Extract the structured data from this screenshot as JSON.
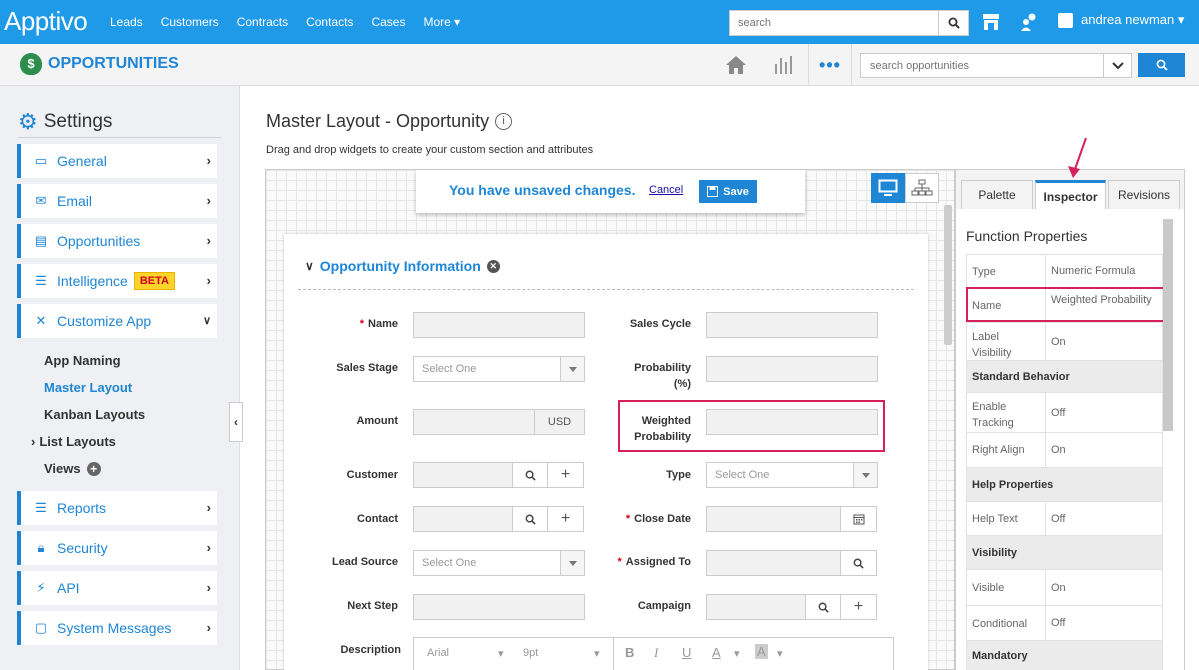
{
  "topnav": {
    "logo": "Apptivo",
    "links": [
      "Leads",
      "Customers",
      "Contracts",
      "Contacts",
      "Cases",
      "More ▾"
    ],
    "search_placeholder": "search",
    "user_name": "andrea newman ▾"
  },
  "appbar": {
    "title": "OPPORTUNITIES",
    "search_placeholder": "search opportunities"
  },
  "sidebar": {
    "heading": "Settings",
    "items": [
      {
        "label": "General",
        "icon": "monitor-icon"
      },
      {
        "label": "Email",
        "icon": "envelope-icon"
      },
      {
        "label": "Opportunities",
        "icon": "form-icon"
      },
      {
        "label": "Intelligence",
        "icon": "list-icon",
        "badge": "BETA"
      },
      {
        "label": "Customize App",
        "icon": "tools-icon"
      },
      {
        "label": "Reports",
        "icon": "report-icon"
      },
      {
        "label": "Security",
        "icon": "lock-icon"
      },
      {
        "label": "API",
        "icon": "plug-icon"
      },
      {
        "label": "System Messages",
        "icon": "message-icon"
      }
    ],
    "subitems": [
      "App Naming",
      "Master Layout",
      "Kanban Layouts",
      "List Layouts",
      "Views"
    ],
    "active_subitem": "Master Layout"
  },
  "main": {
    "title": "Master Layout - Opportunity",
    "subtitle": "Drag and drop widgets to create your custom section and attributes",
    "unsaved": {
      "message": "You have unsaved changes.",
      "cancel": "Cancel",
      "save": "Save"
    },
    "section_title": "Opportunity Information",
    "fields": {
      "name": "Name",
      "sales_cycle": "Sales Cycle",
      "sales_stage": "Sales Stage",
      "sales_stage_value": "Select One",
      "probability_l1": "Probability",
      "probability_l2": "(%)",
      "amount": "Amount",
      "currency": "USD",
      "weighted_l1": "Weighted",
      "weighted_l2": "Probability",
      "customer": "Customer",
      "type": "Type",
      "type_value": "Select One",
      "contact": "Contact",
      "close_date": "Close Date",
      "lead_source": "Lead Source",
      "lead_source_value": "Select One",
      "assigned_to": "Assigned To",
      "next_step": "Next Step",
      "campaign": "Campaign",
      "description": "Description"
    },
    "editor_toolbar": {
      "font": "Arial",
      "size": "9pt"
    }
  },
  "panel": {
    "tabs": [
      "Palette",
      "Inspector",
      "Revisions"
    ],
    "active_tab": "Inspector",
    "heading": "Function Properties",
    "rows": [
      {
        "k": "Type",
        "v": "Numeric Formula"
      },
      {
        "k": "Name",
        "v": "Weighted Probability"
      },
      {
        "k": "Label Visibility",
        "v": "On"
      },
      {
        "section": "Standard Behavior"
      },
      {
        "k": "Enable Tracking",
        "v": "Off"
      },
      {
        "k": "Right Align",
        "v": "On"
      },
      {
        "section": "Help Properties"
      },
      {
        "k": "Help Text",
        "v": "Off"
      },
      {
        "section": "Visibility"
      },
      {
        "k": "Visible",
        "v": "On"
      },
      {
        "k": "Conditional",
        "v": "Off"
      },
      {
        "section": "Mandatory"
      }
    ]
  },
  "colors": {
    "brand": "#1e9ae8",
    "accent": "#1e86d4",
    "highlight": "#d6205a",
    "beta": "#ffd42a"
  }
}
